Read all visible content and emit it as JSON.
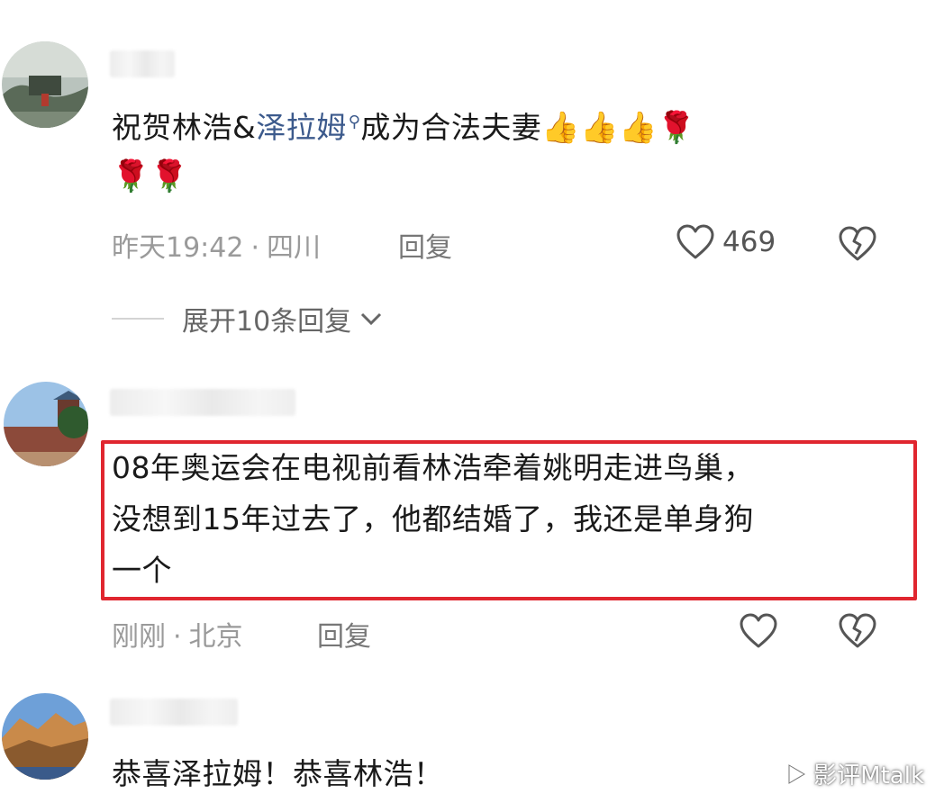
{
  "comments": [
    {
      "text_prefix": "祝贺林浩&",
      "mention": "泽拉姆",
      "text_suffix": "成为合法夫妻",
      "emoji_line1": "👍👍👍🌹",
      "emoji_line2": "🌹🌹",
      "time": "昨天19:42",
      "location": "四川",
      "reply_label": "回复",
      "likes": "469",
      "expand_label": "展开10条回复"
    },
    {
      "line1": "08年奥运会在电视前看林浩牵着姚明走进鸟巢，",
      "line2": "没想到15年过去了，他都结婚了，我还是单身狗",
      "line3": "一个",
      "time": "刚刚",
      "location": "北京",
      "reply_label": "回复"
    },
    {
      "text": "恭喜泽拉姆！恭喜林浩！"
    }
  ],
  "separator": "·",
  "watermark": "影评Mtalk",
  "colors": {
    "highlight_border": "#e0262f",
    "mention": "#3c5a8c",
    "meta": "#9a9a9a"
  },
  "icons": [
    "search-mini-icon",
    "heart-icon",
    "broken-heart-icon",
    "chevron-down-icon",
    "play-icon"
  ]
}
